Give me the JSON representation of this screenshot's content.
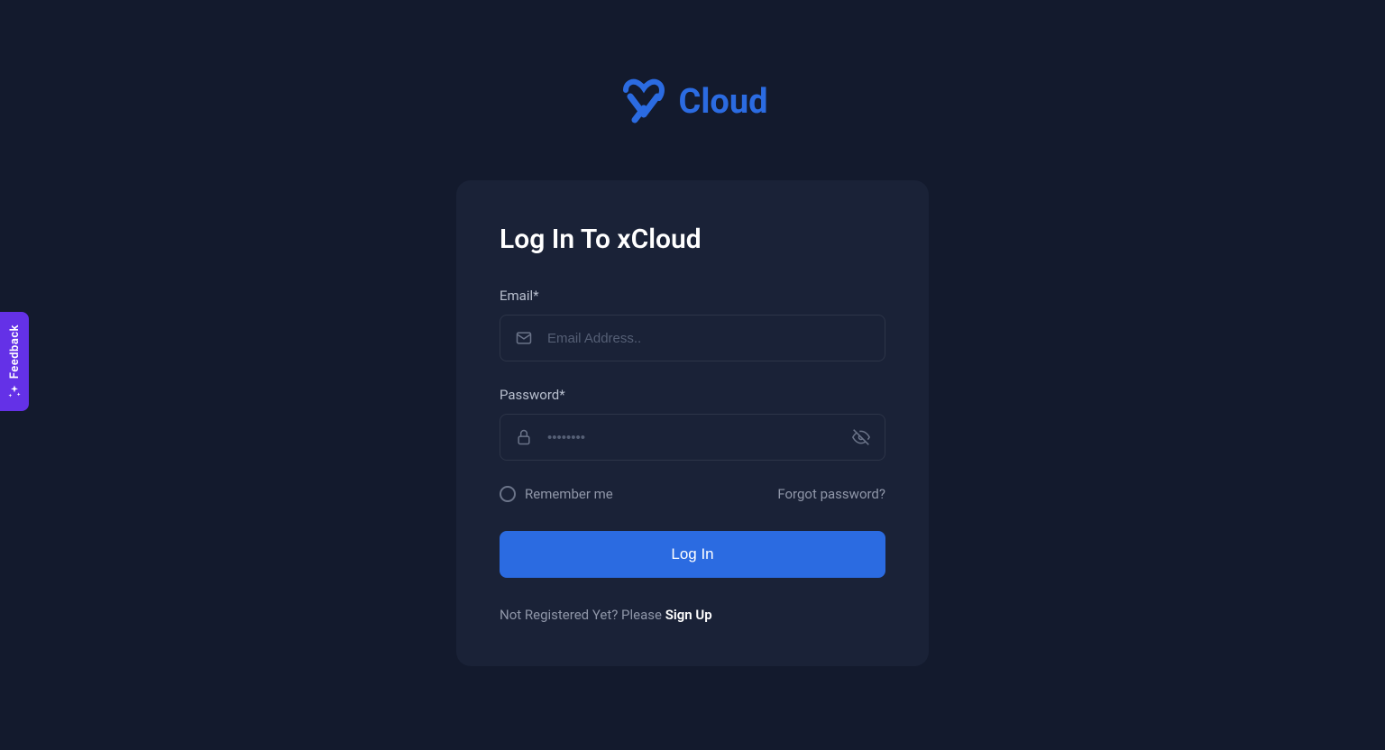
{
  "brand": {
    "name": "Cloud",
    "accent_color": "#2b6be1"
  },
  "card": {
    "title": "Log In To xCloud"
  },
  "form": {
    "email": {
      "label": "Email*",
      "placeholder": "Email Address..",
      "value": ""
    },
    "password": {
      "label": "Password*",
      "placeholder": "••••••••",
      "value": ""
    },
    "remember_label": "Remember me",
    "forgot_label": "Forgot password?",
    "submit_label": "Log In"
  },
  "signup": {
    "prefix": "Not Registered Yet? Please ",
    "link_label": "Sign Up"
  },
  "feedback": {
    "label": "Feedback"
  }
}
